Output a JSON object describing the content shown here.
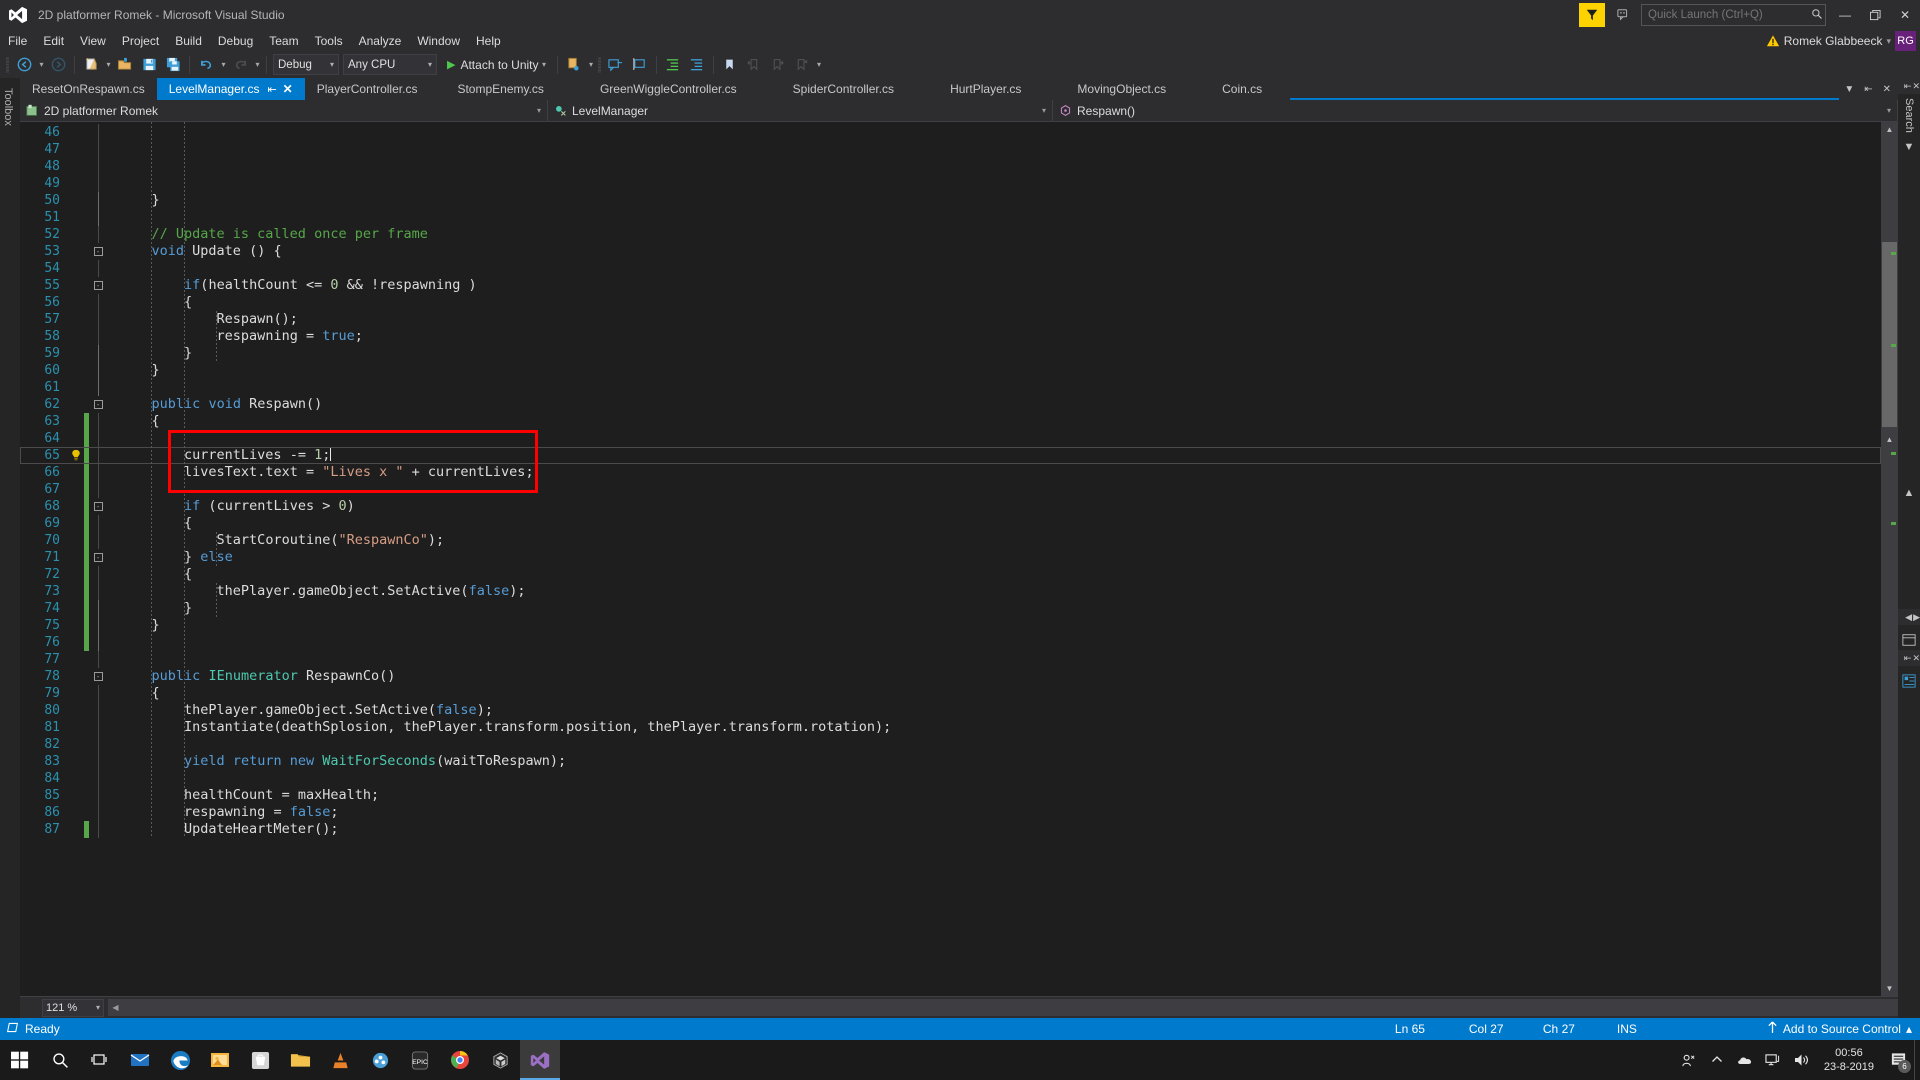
{
  "titlebar": {
    "app_title": "2D platformer Romek - Microsoft Visual Studio",
    "logo_icon": "visual-studio-logo-icon",
    "feedback_icon": "feedback-flag-icon",
    "feedback_smiley_icon": "feedback-smiley-icon",
    "quick_launch_placeholder": "Quick Launch (Ctrl+Q)",
    "quick_launch_value": "",
    "search_icon": "magnifier-icon",
    "minimize": "—",
    "maximize": "❐",
    "close": "✕"
  },
  "menubar": {
    "items": [
      {
        "label": "File"
      },
      {
        "label": "Edit"
      },
      {
        "label": "View"
      },
      {
        "label": "Project"
      },
      {
        "label": "Build"
      },
      {
        "label": "Debug"
      },
      {
        "label": "Team"
      },
      {
        "label": "Tools"
      },
      {
        "label": "Analyze"
      },
      {
        "label": "Window"
      },
      {
        "label": "Help"
      }
    ],
    "account": {
      "warning_icon": "warning-triangle-icon",
      "user_name": "Romek Glabbeeck",
      "caret": "▾",
      "initials": "RG"
    }
  },
  "toolbar": {
    "nav_back_icon": "navigate-back-icon",
    "nav_forward_icon": "navigate-forward-icon",
    "new_project_icon": "new-project-icon",
    "open_file_icon": "open-file-icon",
    "save_icon": "save-icon",
    "save_all_icon": "save-all-icon",
    "undo_icon": "undo-icon",
    "redo_icon": "redo-icon",
    "config_value": "Debug",
    "platform_value": "Any CPU",
    "run_label": "Attach to Unity",
    "run_play_icon": "play-triangle-icon",
    "step_icon": "step-into-icon",
    "comment_icon": "comment-selection-icon",
    "uncomment_icon": "uncomment-selection-icon",
    "indent_icon": "increase-indent-icon",
    "outdent_icon": "decrease-indent-icon",
    "bookmark_icon": "bookmark-icon",
    "prev_bookmark_icon": "previous-bookmark-icon",
    "next_bookmark_icon": "next-bookmark-icon",
    "clear_bookmarks_icon": "clear-bookmarks-icon",
    "caret": "▾"
  },
  "toolbox": {
    "label": "Toolbox"
  },
  "tabs": {
    "items": [
      {
        "label": "ResetOnRespawn.cs",
        "active": false
      },
      {
        "label": "LevelManager.cs",
        "active": true,
        "pin_icon": "pin-icon",
        "close_icon": "close-tab-icon"
      },
      {
        "label": "PlayerController.cs",
        "active": false
      },
      {
        "label": "StompEnemy.cs",
        "active": false
      },
      {
        "label": "GreenWiggleController.cs",
        "active": false
      },
      {
        "label": "SpiderController.cs",
        "active": false
      },
      {
        "label": "HurtPlayer.cs",
        "active": false
      },
      {
        "label": "MovingObject.cs",
        "active": false
      },
      {
        "label": "Coin.cs",
        "active": false
      }
    ],
    "overflow_icon": "tab-overflow-chevron-icon",
    "pin_icon": "pin-window-icon",
    "close_icon": "close-window-icon"
  },
  "navbar": {
    "project": "2D platformer Romek",
    "project_icon": "csharp-project-icon",
    "type": "LevelManager",
    "type_icon": "class-icon",
    "member": "Respawn()",
    "member_icon": "method-icon",
    "caret": "▾"
  },
  "editor": {
    "language": "csharp",
    "first_visible_line": 46,
    "current_line": 65,
    "lightbulb_icon": "lightbulb-suggestion-icon",
    "lines": [
      {
        "n": 46,
        "text": "",
        "indent": 2
      },
      {
        "n": 47,
        "text": "",
        "indent": 2
      },
      {
        "n": 48,
        "text": "",
        "indent": 2
      },
      {
        "n": 49,
        "text": "",
        "indent": 2
      },
      {
        "n": 50,
        "text": "    }",
        "indent": 1
      },
      {
        "n": 51,
        "text": "",
        "indent": 1
      },
      {
        "n": 52,
        "text": "    // Update is called once per frame",
        "indent": 1
      },
      {
        "n": 53,
        "text": "    void Update () {",
        "indent": 1,
        "fold": "minus"
      },
      {
        "n": 54,
        "text": "",
        "indent": 2
      },
      {
        "n": 55,
        "text": "        if(healthCount <= 0 && !respawning )",
        "indent": 2,
        "fold": "minus"
      },
      {
        "n": 56,
        "text": "        {",
        "indent": 2
      },
      {
        "n": 57,
        "text": "            Respawn();",
        "indent": 3
      },
      {
        "n": 58,
        "text": "            respawning = true;",
        "indent": 3
      },
      {
        "n": 59,
        "text": "        }",
        "indent": 2
      },
      {
        "n": 60,
        "text": "    }",
        "indent": 1
      },
      {
        "n": 61,
        "text": "",
        "indent": 1
      },
      {
        "n": 62,
        "text": "    public void Respawn()",
        "indent": 1,
        "fold": "minus"
      },
      {
        "n": 63,
        "text": "    {",
        "indent": 1,
        "changed": true
      },
      {
        "n": 64,
        "text": "",
        "indent": 2,
        "changed": true
      },
      {
        "n": 65,
        "text": "        currentLives -= 1;",
        "indent": 2,
        "changed": true,
        "current": true
      },
      {
        "n": 66,
        "text": "        livesText.text = \"Lives x \" + currentLives;",
        "indent": 2,
        "changed": true
      },
      {
        "n": 67,
        "text": "",
        "indent": 2,
        "changed": true
      },
      {
        "n": 68,
        "text": "        if (currentLives > 0)",
        "indent": 2,
        "changed": true,
        "fold": "minus"
      },
      {
        "n": 69,
        "text": "        {",
        "indent": 2,
        "changed": true
      },
      {
        "n": 70,
        "text": "            StartCoroutine(\"RespawnCo\");",
        "indent": 3,
        "changed": true
      },
      {
        "n": 71,
        "text": "        } else",
        "indent": 2,
        "changed": true,
        "fold": "minus"
      },
      {
        "n": 72,
        "text": "        {",
        "indent": 2,
        "changed": true
      },
      {
        "n": 73,
        "text": "            thePlayer.gameObject.SetActive(false);",
        "indent": 3,
        "changed": true
      },
      {
        "n": 74,
        "text": "        }",
        "indent": 2,
        "changed": true
      },
      {
        "n": 75,
        "text": "    }",
        "indent": 1,
        "changed": true
      },
      {
        "n": 76,
        "text": "",
        "indent": 1,
        "changed": true
      },
      {
        "n": 77,
        "text": "",
        "indent": 1
      },
      {
        "n": 78,
        "text": "    public IEnumerator RespawnCo()",
        "indent": 1,
        "fold": "minus"
      },
      {
        "n": 79,
        "text": "    {",
        "indent": 1
      },
      {
        "n": 80,
        "text": "        thePlayer.gameObject.SetActive(false);",
        "indent": 2
      },
      {
        "n": 81,
        "text": "        Instantiate(deathSplosion, thePlayer.transform.position, thePlayer.transform.rotation);",
        "indent": 2
      },
      {
        "n": 82,
        "text": "",
        "indent": 2
      },
      {
        "n": 83,
        "text": "        yield return new WaitForSeconds(waitToRespawn);",
        "indent": 2
      },
      {
        "n": 84,
        "text": "",
        "indent": 2
      },
      {
        "n": 85,
        "text": "        healthCount = maxHealth;",
        "indent": 2
      },
      {
        "n": 86,
        "text": "        respawning = false;",
        "indent": 2
      },
      {
        "n": 87,
        "text": "        UpdateHeartMeter();",
        "indent": 2,
        "changed": true
      }
    ],
    "annotation": {
      "type": "red-rectangle-highlight",
      "color": "#ff0000",
      "covers_lines": [
        64,
        66
      ]
    },
    "zoom_level": "121 %",
    "zoom_caret": "▾"
  },
  "right_panels": {
    "search_label": "Search",
    "solution_explorer_icon": "solution-explorer-icon",
    "properties_icon": "properties-window-icon",
    "pin_icon": "pin-icon",
    "close_icon": "close-icon"
  },
  "statusbar": {
    "status_icon": "ready-status-icon",
    "status": "Ready",
    "line": "Ln 65",
    "col": "Col 27",
    "ch": "Ch 27",
    "insert_mode": "INS",
    "source_control_icon": "upload-arrow-icon",
    "source_control": "Add to Source Control",
    "source_control_caret": "▴"
  },
  "taskbar": {
    "start_icon": "windows-start-icon",
    "search_icon": "taskbar-search-icon",
    "taskview_icon": "task-view-icon",
    "items": [
      {
        "icon": "mail-icon",
        "name": "mail-app",
        "active": false
      },
      {
        "icon": "edge-icon",
        "name": "microsoft-edge",
        "active": false
      },
      {
        "icon": "photos-icon",
        "name": "photos-app",
        "active": false
      },
      {
        "icon": "store-icon",
        "name": "microsoft-store",
        "active": false
      },
      {
        "icon": "file-explorer-icon",
        "name": "file-explorer",
        "active": false
      },
      {
        "icon": "vlc-icon",
        "name": "vlc-media-player",
        "active": false
      },
      {
        "icon": "paint-icon",
        "name": "paint-app",
        "active": false
      },
      {
        "icon": "epic-games-icon",
        "name": "epic-games-launcher",
        "active": false
      },
      {
        "icon": "chrome-icon",
        "name": "google-chrome",
        "active": false
      },
      {
        "icon": "unity-icon",
        "name": "unity-editor",
        "active": false
      },
      {
        "icon": "visual-studio-icon",
        "name": "visual-studio",
        "active": true
      }
    ],
    "tray": {
      "people_icon": "people-icon",
      "chevron_icon": "show-hidden-icons-chevron",
      "onedrive_icon": "onedrive-cloud-icon",
      "network_icon": "network-monitor-icon",
      "volume_icon": "volume-speaker-icon",
      "time": "00:56",
      "date": "23-8-2019",
      "notification_icon": "action-center-icon",
      "notification_count": "6"
    }
  }
}
